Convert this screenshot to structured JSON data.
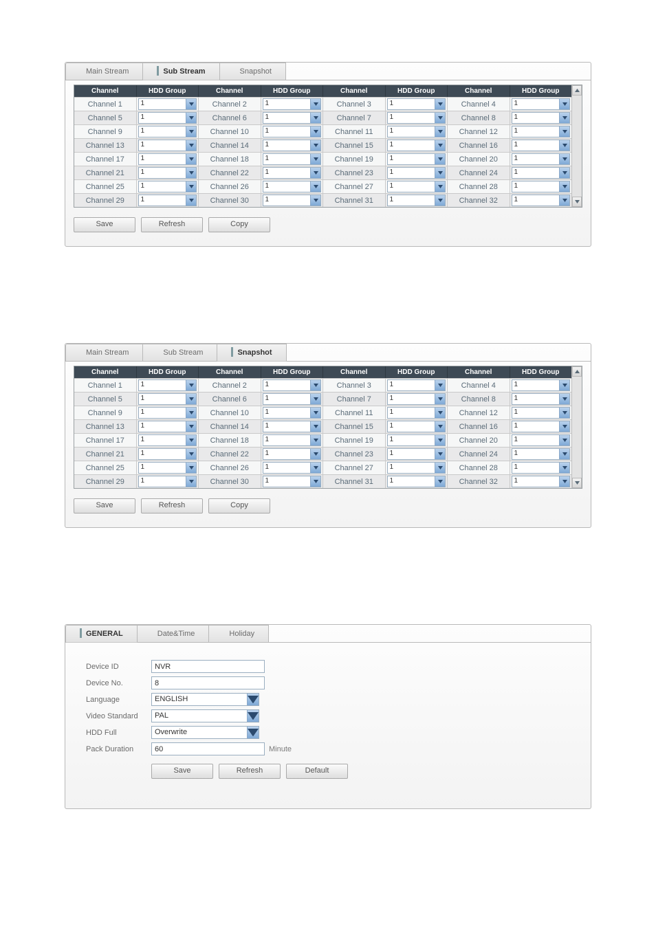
{
  "headers": [
    "Channel",
    "HDD Group",
    "Channel",
    "HDD Group",
    "Channel",
    "HDD Group",
    "Channel",
    "HDD Group"
  ],
  "buttons": {
    "save": "Save",
    "refresh": "Refresh",
    "copy": "Copy",
    "default": "Default"
  },
  "dropdown_value": "1",
  "panel1": {
    "tabs": [
      "Main Stream",
      "Sub Stream",
      "Snapshot"
    ],
    "active_tab": 1,
    "rows": [
      [
        "Channel 1",
        "Channel 2",
        "Channel 3",
        "Channel 4"
      ],
      [
        "Channel 5",
        "Channel 6",
        "Channel 7",
        "Channel 8"
      ],
      [
        "Channel 9",
        "Channel 10",
        "Channel 11",
        "Channel 12"
      ],
      [
        "Channel 13",
        "Channel 14",
        "Channel 15",
        "Channel 16"
      ],
      [
        "Channel 17",
        "Channel 18",
        "Channel 19",
        "Channel 20"
      ],
      [
        "Channel 21",
        "Channel 22",
        "Channel 23",
        "Channel 24"
      ],
      [
        "Channel 25",
        "Channel 26",
        "Channel 27",
        "Channel 28"
      ],
      [
        "Channel 29",
        "Channel 30",
        "Channel 31",
        "Channel 32"
      ]
    ]
  },
  "panel2": {
    "tabs": [
      "Main Stream",
      "Sub Stream",
      "Snapshot"
    ],
    "active_tab": 2,
    "rows": [
      [
        "Channel 1",
        "Channel 2",
        "Channel 3",
        "Channel 4"
      ],
      [
        "Channel 5",
        "Channel 6",
        "Channel 7",
        "Channel 8"
      ],
      [
        "Channel 9",
        "Channel 10",
        "Channel 11",
        "Channel 12"
      ],
      [
        "Channel 13",
        "Channel 14",
        "Channel 15",
        "Channel 16"
      ],
      [
        "Channel 17",
        "Channel 18",
        "Channel 19",
        "Channel 20"
      ],
      [
        "Channel 21",
        "Channel 22",
        "Channel 23",
        "Channel 24"
      ],
      [
        "Channel 25",
        "Channel 26",
        "Channel 27",
        "Channel 28"
      ],
      [
        "Channel 29",
        "Channel 30",
        "Channel 31",
        "Channel 32"
      ]
    ]
  },
  "panel3": {
    "tabs": [
      "GENERAL",
      "Date&Time",
      "Holiday"
    ],
    "active_tab": 0,
    "fields": {
      "device_id": {
        "label": "Device ID",
        "value": "NVR"
      },
      "device_no": {
        "label": "Device No.",
        "value": "8"
      },
      "language": {
        "label": "Language",
        "value": "ENGLISH"
      },
      "video_standard": {
        "label": "Video Standard",
        "value": "PAL"
      },
      "hdd_full": {
        "label": "HDD Full",
        "value": "Overwrite"
      },
      "pack_duration": {
        "label": "Pack Duration",
        "value": "60",
        "unit": "Minute"
      }
    }
  }
}
